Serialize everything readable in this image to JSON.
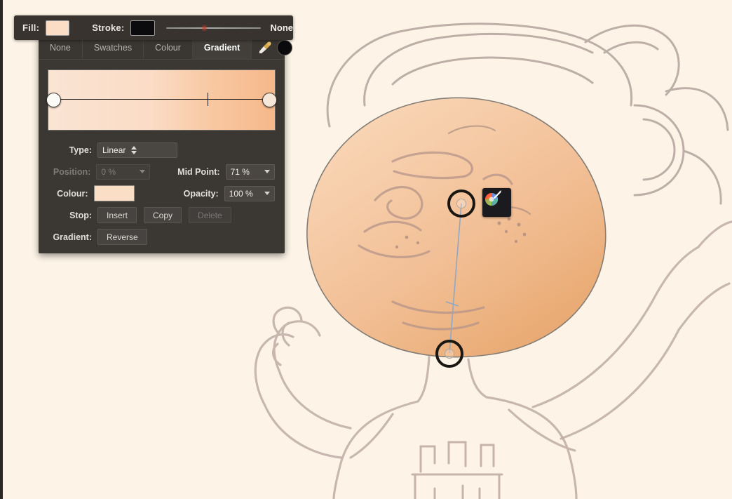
{
  "toolbar": {
    "fill_label": "Fill:",
    "fill_color": "#fbdcc4",
    "stroke_label": "Stroke:",
    "stroke_color": "#0b0b0d",
    "stroke_width_value": "None"
  },
  "panel": {
    "tabs": [
      {
        "label": "None",
        "active": false
      },
      {
        "label": "Swatches",
        "active": false
      },
      {
        "label": "Colour",
        "active": false
      },
      {
        "label": "Gradient",
        "active": true
      }
    ],
    "tools": {
      "eyedropper": "eyedropper-icon",
      "swatch_color": "#0a0a0c"
    },
    "gradient_preview": {
      "start_color": "#fae4d3",
      "end_color": "#f6b88a",
      "mid_point_pct": 70
    },
    "rows": {
      "type_label": "Type:",
      "type_value": "Linear",
      "position_label": "Position:",
      "position_value": "0 %",
      "midpoint_label": "Mid Point:",
      "midpoint_value": "71 %",
      "colour_label": "Colour:",
      "colour_value": "#fbdec6",
      "opacity_label": "Opacity:",
      "opacity_value": "100 %",
      "stop_label": "Stop:",
      "stop_insert": "Insert",
      "stop_copy": "Copy",
      "stop_delete": "Delete",
      "gradient_label": "Gradient:",
      "gradient_reverse": "Reverse"
    }
  },
  "canvas": {
    "background_color": "#fdf4e7",
    "shape_fill_start": "#f8cfae",
    "shape_fill_end": "#e8a169",
    "wheel_button": "colour-wheel-icon",
    "start_handle": "gradient-start-handle",
    "end_handle": "gradient-end-handle"
  }
}
